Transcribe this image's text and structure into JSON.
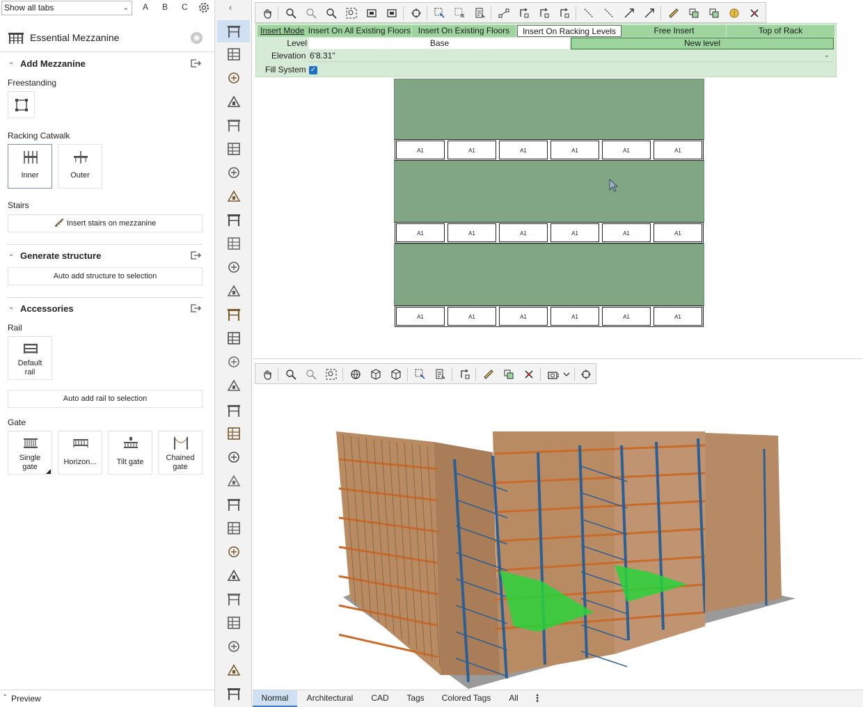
{
  "topbar": {
    "tab_select_value": "Show all tabs",
    "letters": [
      "A",
      "B",
      "C"
    ]
  },
  "panel": {
    "title": "Essential Mezzanine",
    "sections": {
      "add": {
        "heading": "Add Mezzanine",
        "freestanding_label": "Freestanding",
        "catwalk_label": "Racking Catwalk",
        "catwalk_items": [
          "Inner",
          "Outer"
        ],
        "stairs_label": "Stairs",
        "stairs_button": "Insert stairs on mezzanine"
      },
      "generate": {
        "heading": "Generate structure",
        "button": "Auto add structure to selection"
      },
      "accessories": {
        "heading": "Accessories",
        "rail_label": "Rail",
        "rail_items": [
          "Default\nrail"
        ],
        "rail_button": "Auto add rail to selection",
        "gate_label": "Gate",
        "gate_items": [
          "Single\ngate",
          "Horizon...",
          "Tilt gate",
          "Chained\ngate"
        ]
      }
    },
    "preview_label": "Preview"
  },
  "context": {
    "modes": [
      "Insert Mode",
      "Insert On All Existing Floors",
      "Insert On Existing Floors",
      "Insert On Racking Levels",
      "Free Insert",
      "Top of Rack"
    ],
    "active_mode": "Insert On Racking Levels",
    "level_label": "Level",
    "levels": [
      "Base",
      "New level"
    ],
    "selected_level": "New level",
    "elevation_label": "Elevation",
    "elevation_value": "6'8.31\"",
    "fill_label": "Fill System",
    "fill_checked": true
  },
  "plan": {
    "cell_label": "A1",
    "rows": 3,
    "cells_per_row": 6
  },
  "view_tabs": {
    "items": [
      "Normal",
      "Architectural",
      "CAD",
      "Tags",
      "Colored Tags",
      "All"
    ],
    "active": "Normal"
  },
  "colors": {
    "mezzanine_plan": "#80a683",
    "context_bar": "#d6ebd6",
    "mode_row": "#9ed49e",
    "accent": "#3f7ac2",
    "rack_upright": "#2d5f93",
    "rack_beam": "#c86a2a",
    "carton": "#b98b63",
    "deck_green": "#29d23a",
    "floor": "#9a9a9a"
  }
}
